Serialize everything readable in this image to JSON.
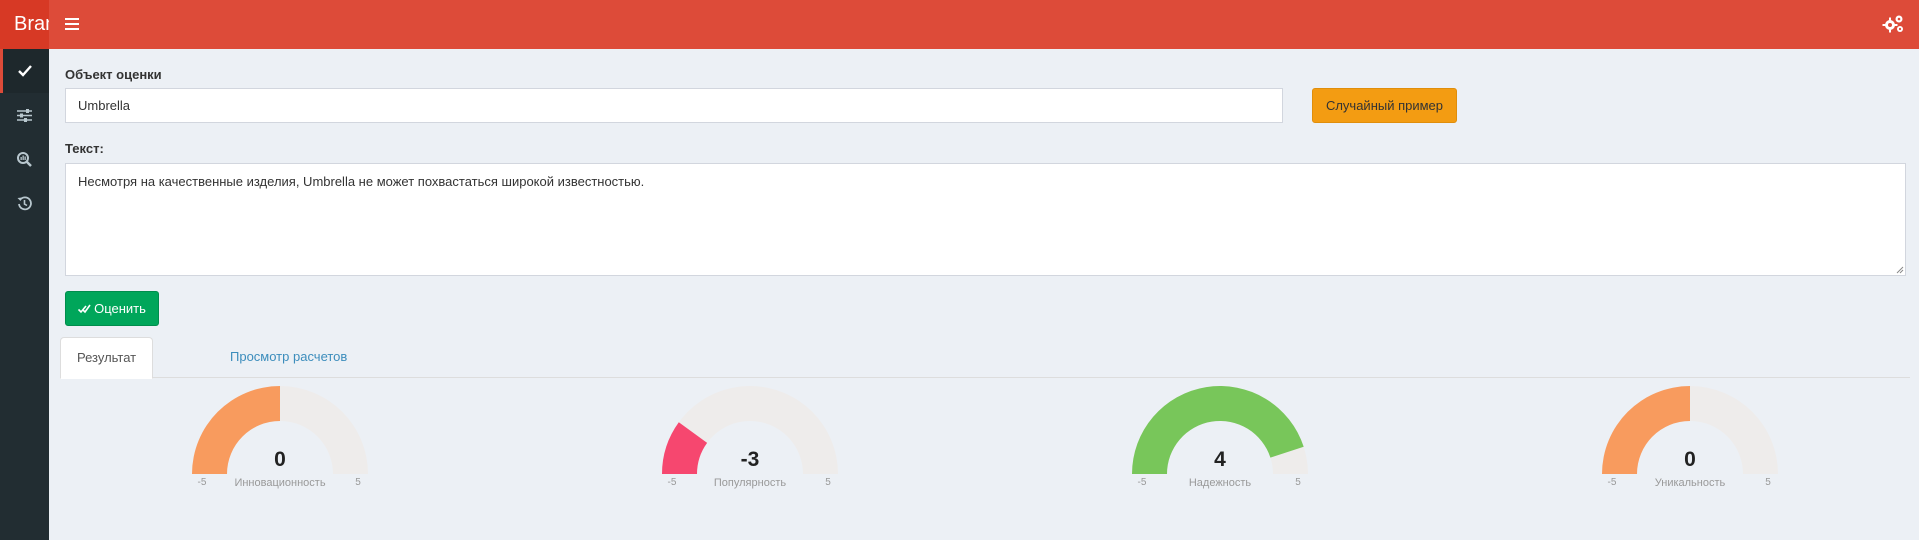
{
  "header": {
    "brand": "Brand"
  },
  "form": {
    "object_label": "Объект оценки",
    "object_value": "Umbrella",
    "random_button": "Случайный пример",
    "text_label": "Текст:",
    "text_value": "Несмотря на качественные изделия, Umbrella не может похвастаться широкой известностью.",
    "evaluate_button": "Оценить"
  },
  "tabs": [
    {
      "label": "Результат",
      "active": true
    },
    {
      "label": "Просмотр расчетов",
      "active": false
    }
  ],
  "gauges": [
    {
      "value": 0,
      "min": -5,
      "max": 5,
      "label": "Инновационность",
      "color": "#f89b5e"
    },
    {
      "value": -3,
      "min": -5,
      "max": 5,
      "label": "Популярность",
      "color": "#f6476f"
    },
    {
      "value": 4,
      "min": -5,
      "max": 5,
      "label": "Надежность",
      "color": "#78c65a"
    },
    {
      "value": 0,
      "min": -5,
      "max": 5,
      "label": "Уникальность",
      "color": "#f89b5e"
    }
  ],
  "colors": {
    "header": "#dd4b39",
    "sidebar": "#222d32",
    "gauge_track": "#eeeceb",
    "warning": "#f39c12",
    "success": "#00a65a"
  }
}
